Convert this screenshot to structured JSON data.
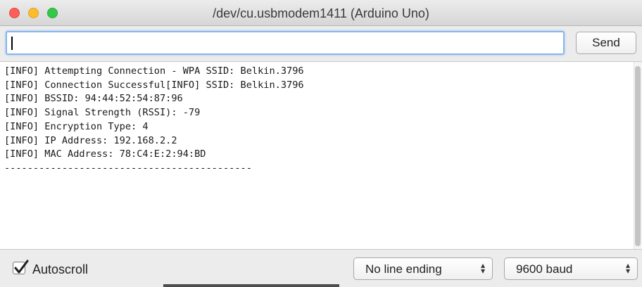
{
  "window": {
    "title": "/dev/cu.usbmodem1411 (Arduino Uno)"
  },
  "input_bar": {
    "value": "",
    "send_label": "Send"
  },
  "console": {
    "lines": [
      "[INFO] Attempting Connection - WPA SSID: Belkin.3796",
      "[INFO] Connection Successful[INFO] SSID: Belkin.3796",
      "[INFO] BSSID: 94:44:52:54:87:96",
      "[INFO] Signal Strength (RSSI): -79",
      "[INFO] Encryption Type: 4",
      "[INFO] IP Address: 192.168.2.2",
      "[INFO] MAC Address: 78:C4:E:2:94:BD",
      "-------------------------------------------"
    ]
  },
  "bottom_bar": {
    "autoscroll_label": "Autoscroll",
    "autoscroll_checked": true,
    "line_ending": "No line ending",
    "baud_rate": "9600 baud"
  },
  "colors": {
    "close": "#fc5f57",
    "minimize": "#fdbc2e",
    "maximize": "#34c748",
    "focus_ring": "#86b6ef"
  },
  "icons": [
    "close-icon",
    "minimize-icon",
    "maximize-icon",
    "checkmark-icon",
    "updown-arrows-icon"
  ]
}
